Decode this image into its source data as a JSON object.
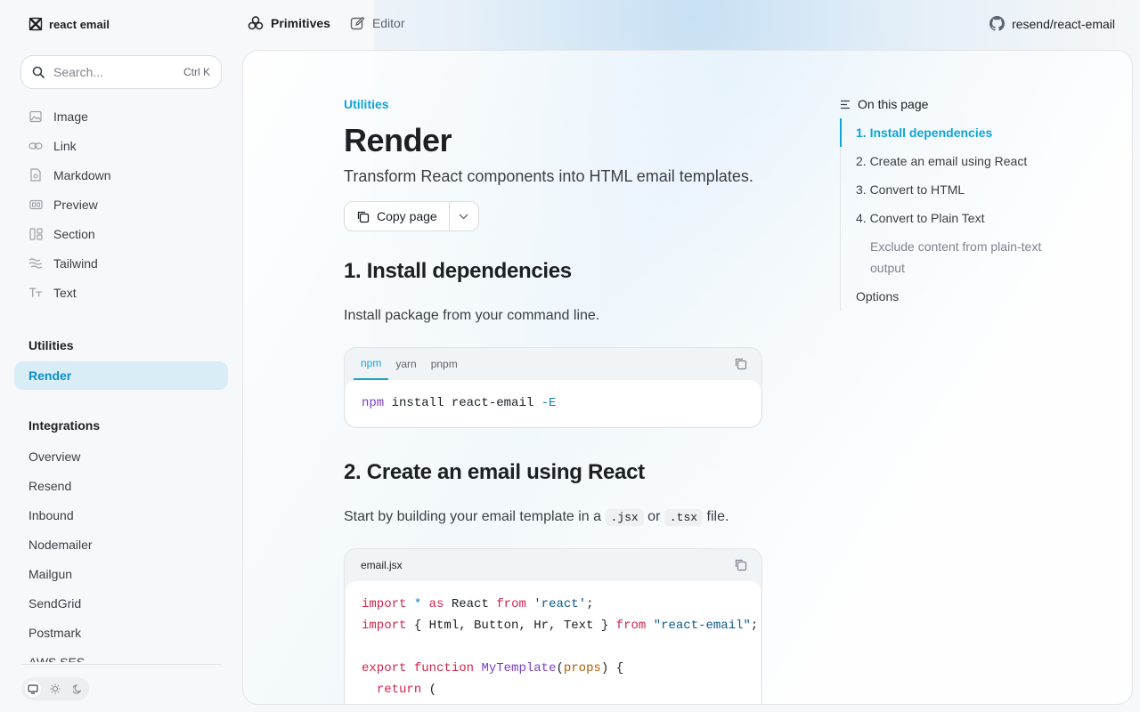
{
  "brand": {
    "name": "react email"
  },
  "topnav": [
    {
      "label": "Primitives",
      "active": true
    },
    {
      "label": "Editor",
      "active": false
    }
  ],
  "repo": {
    "label": "resend/react-email"
  },
  "search": {
    "placeholder": "Search...",
    "shortcut": "Ctrl K"
  },
  "sidebar": {
    "components": [
      {
        "label": "Image",
        "icon": "image-icon"
      },
      {
        "label": "Link",
        "icon": "link-icon"
      },
      {
        "label": "Markdown",
        "icon": "markdown-icon"
      },
      {
        "label": "Preview",
        "icon": "preview-icon"
      },
      {
        "label": "Section",
        "icon": "section-icon"
      },
      {
        "label": "Tailwind",
        "icon": "tailwind-icon"
      },
      {
        "label": "Text",
        "icon": "text-icon"
      }
    ],
    "utilities_heading": "Utilities",
    "utilities": [
      {
        "label": "Render",
        "active": true
      }
    ],
    "integrations_heading": "Integrations",
    "integrations": [
      "Overview",
      "Resend",
      "Inbound",
      "Nodemailer",
      "Mailgun",
      "SendGrid",
      "Postmark",
      "AWS SES"
    ]
  },
  "page": {
    "breadcrumb": "Utilities",
    "title": "Render",
    "subtitle": "Transform React components into HTML email templates.",
    "copy_label": "Copy page",
    "section1": {
      "heading": "1. Install dependencies",
      "text": "Install package from your command line.",
      "tabs": [
        "npm",
        "yarn",
        "pnpm"
      ],
      "code": {
        "cmd": "npm",
        "rest": " install react-email ",
        "flag": "-E"
      }
    },
    "section2": {
      "heading": "2. Create an email using React",
      "text_before": "Start by building your email template in a",
      "code1": ".jsx",
      "text_mid": "or",
      "code2": ".tsx",
      "text_after": "file.",
      "filename": "email.jsx"
    }
  },
  "toc": {
    "heading": "On this page",
    "items": [
      {
        "label": "1. Install dependencies",
        "active": true
      },
      {
        "label": "2. Create an email using React"
      },
      {
        "label": "3. Convert to HTML"
      },
      {
        "label": "4. Convert to Plain Text"
      }
    ],
    "sub": "Exclude content from plain-text output",
    "options": "Options"
  },
  "colors": {
    "accent": "#0fa4d6",
    "active_bg": "#d9edf6"
  }
}
